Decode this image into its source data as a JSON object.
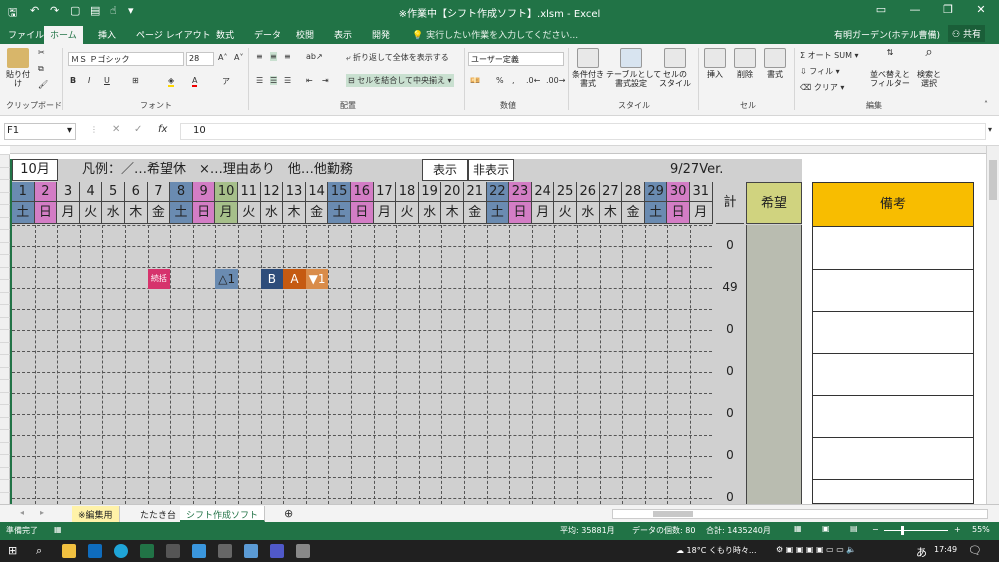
{
  "window": {
    "title": "※作業中【シフト作成ソフト】.xlsm - Excel",
    "user": "有明ガーデン(ホテル曹備)",
    "share": "共有"
  },
  "ribbon_tabs": [
    "ファイル",
    "ホーム",
    "挿入",
    "ページ レイアウト",
    "数式",
    "データ",
    "校閲",
    "表示",
    "開発"
  ],
  "tell_me": "実行したい作業を入力してください...",
  "ribbon": {
    "clipboard": {
      "paste": "貼り付け",
      "group": "クリップボード"
    },
    "font": {
      "name": "ＭＳ Ｐゴシック",
      "size": "28",
      "group": "フォント"
    },
    "alignment": {
      "wrap": "折り返して全体を表示する",
      "merge": "セルを結合して中央揃え",
      "group": "配置"
    },
    "number": {
      "format": "ユーザー定義",
      "group": "数値"
    },
    "styles": {
      "conditional": "条件付き\n書式",
      "table": "テーブルとして\n書式設定",
      "cell": "セルの\nスタイル",
      "group": "スタイル"
    },
    "cells": {
      "insert": "挿入",
      "delete": "削除",
      "format": "書式",
      "group": "セル"
    },
    "editing": {
      "autosum": "オート SUM",
      "fill": "フィル",
      "clear": "クリア",
      "sort": "並べ替えと\nフィルター",
      "find": "検索と\n選択",
      "group": "編集"
    }
  },
  "formula_bar": {
    "name_box": "F1",
    "fx": "fx",
    "value": "10"
  },
  "sheet": {
    "month": "10月",
    "legend": "凡例：／…希望休　×…理由あり　他…他勤務",
    "show": "表示",
    "hide": "非表示",
    "version": "9/27Ver.",
    "days": [
      "1",
      "2",
      "3",
      "4",
      "5",
      "6",
      "7",
      "8",
      "9",
      "10",
      "11",
      "12",
      "13",
      "14",
      "15",
      "16",
      "17",
      "18",
      "19",
      "20",
      "21",
      "22",
      "23",
      "24",
      "25",
      "26",
      "27",
      "28",
      "29",
      "30",
      "31"
    ],
    "weekdays": [
      "土",
      "日",
      "月",
      "火",
      "水",
      "木",
      "金",
      "土",
      "日",
      "月",
      "火",
      "水",
      "木",
      "金",
      "土",
      "日",
      "月",
      "火",
      "水",
      "木",
      "金",
      "土",
      "日",
      "月",
      "火",
      "水",
      "木",
      "金",
      "土",
      "日",
      "月"
    ],
    "total_label": "計",
    "wish_label": "希望",
    "totals": [
      "0",
      "49",
      "0",
      "0",
      "0",
      "0",
      "0"
    ],
    "notes_label": "備考",
    "marks": [
      {
        "text": "続括",
        "color": "#d6336c"
      },
      {
        "text": "△1",
        "color": "#6a8bb1"
      },
      {
        "text": "B",
        "color": "#2e4d7b"
      },
      {
        "text": "A",
        "color": "#c55a11"
      },
      {
        "text": "▼1",
        "color": "#d98c4a"
      }
    ]
  },
  "sheet_tabs": [
    "※編集用",
    "たたき台",
    "シフト作成ソフト"
  ],
  "status": {
    "ready": "準備完了",
    "average": "平均: 35881月",
    "count": "データの個数: 80",
    "sum": "合計: 1435240月",
    "zoom": "55%"
  },
  "taskbar": {
    "weather": "18°C くもり時々...",
    "ime": "あ",
    "time": "17:49"
  }
}
